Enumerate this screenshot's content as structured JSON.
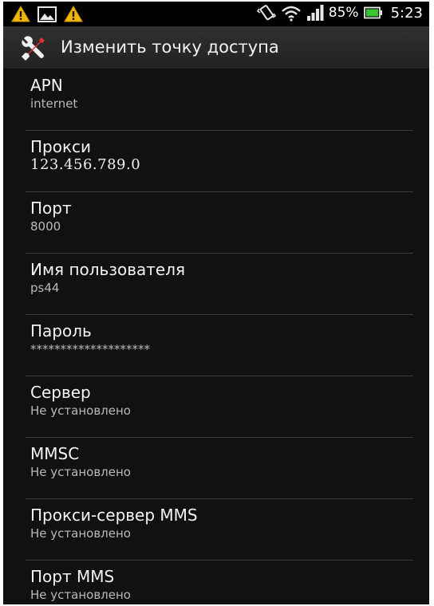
{
  "status_bar": {
    "left_icons": [
      "warning-icon",
      "image-icon",
      "warning-icon"
    ],
    "right_icons": [
      "vibrate-icon",
      "wifi-icon",
      "signal-icon",
      "battery-icon"
    ],
    "battery": "85%",
    "time": "5:23"
  },
  "action_bar": {
    "icon": "tools-icon",
    "title": "Изменить точку доступа"
  },
  "settings": [
    {
      "label": "APN",
      "value": "internet"
    },
    {
      "label": "Прокси",
      "value": "123.456.789.0"
    },
    {
      "label": "Порт",
      "value": "8000"
    },
    {
      "label": "Имя пользователя",
      "value": "ps44"
    },
    {
      "label": "Пароль",
      "value": "********************"
    },
    {
      "label": "Сервер",
      "value": "Не установлено"
    },
    {
      "label": "MMSC",
      "value": "Не установлено"
    },
    {
      "label": "Прокси-сервер MMS",
      "value": "Не установлено"
    },
    {
      "label": "Порт MMS",
      "value": "Не установлено"
    }
  ],
  "colors": {
    "background": "#111111",
    "status_bar": "#000000",
    "divider": "#3a3a3a",
    "warning_icon": "#f2b705"
  }
}
